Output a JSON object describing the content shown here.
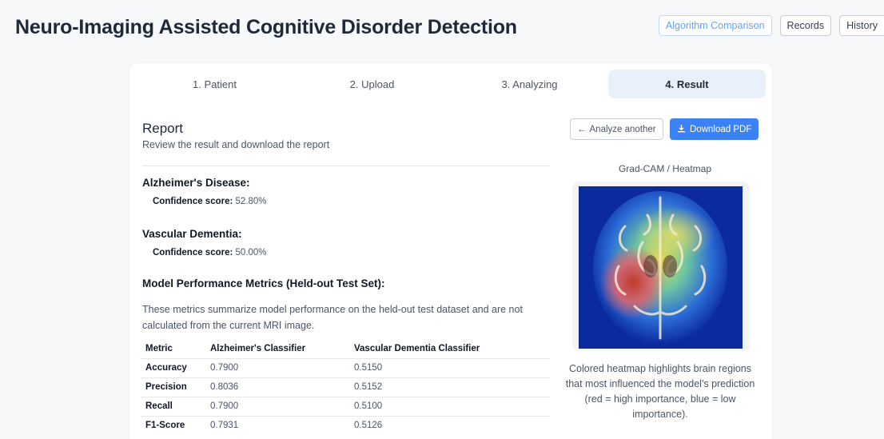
{
  "header": {
    "title": "Neuro-Imaging Assisted Cognitive Disorder Detection",
    "nav": {
      "algorithm_comparison": "Algorithm Comparison",
      "records": "Records",
      "history": "History"
    }
  },
  "steps": [
    "1. Patient",
    "2. Upload",
    "3. Analyzing",
    "4. Result"
  ],
  "report": {
    "title": "Report",
    "subtitle": "Review the result and download the report",
    "alzheimers": {
      "heading": "Alzheimer's Disease:",
      "confidence_label": "Confidence score:",
      "confidence_value": "52.80%"
    },
    "vascular": {
      "heading": "Vascular Dementia:",
      "confidence_label": "Confidence score:",
      "confidence_value": "50.00%"
    },
    "metrics": {
      "heading": "Model Performance Metrics (Held-out Test Set):",
      "note": "These metrics summarize model performance on the held-out test dataset and are not calculated from the current MRI image.",
      "columns": [
        "Metric",
        "Alzheimer's Classifier",
        "Vascular Dementia Classifier"
      ],
      "rows": [
        [
          "Accuracy",
          "0.7900",
          "0.5150"
        ],
        [
          "Precision",
          "0.8036",
          "0.5152"
        ],
        [
          "Recall",
          "0.7900",
          "0.5100"
        ],
        [
          "F1-Score",
          "0.7931",
          "0.5126"
        ]
      ]
    }
  },
  "actions": {
    "analyze_another": "Analyze another",
    "download_pdf": "Download PDF"
  },
  "heatmap": {
    "title": "Grad-CAM / Heatmap",
    "caption": "Colored heatmap highlights brain regions that most influenced the model's prediction (red = high importance, blue = low importance)."
  },
  "icons": {
    "back": "arrow-left-icon",
    "download": "download-icon"
  },
  "colors": {
    "accent": "#3b82f6",
    "active_step_bg": "#e8f1fb",
    "heatmap_bg": "#0b2a9e"
  }
}
